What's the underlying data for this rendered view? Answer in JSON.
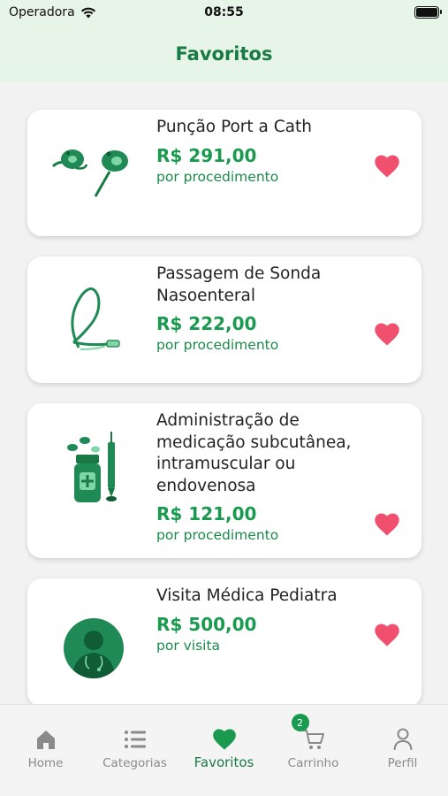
{
  "status_bar": {
    "carrier": "Operadora",
    "time": "08:55"
  },
  "header": {
    "title": "Favoritos"
  },
  "colors": {
    "accent": "#1a7a45",
    "price": "#1a9a4f",
    "heart": "#f0506e",
    "header_bg": "#e7f4e8"
  },
  "favorites": [
    {
      "name": "Punção Port a Cath",
      "price": "R$ 291,00",
      "unit": "por procedimento",
      "icon": "port-a-cath-icon"
    },
    {
      "name": "Passagem de Sonda Nasoenteral",
      "price": "R$ 222,00",
      "unit": "por procedimento",
      "icon": "feeding-tube-icon"
    },
    {
      "name": "Administração de medicação subcutânea, intramuscular ou endovenosa",
      "price": "R$ 121,00",
      "unit": "por procedimento",
      "icon": "medication-syringe-icon"
    },
    {
      "name": "Visita Médica Pediatra",
      "price": "R$ 500,00",
      "unit": "por visita",
      "icon": "doctor-avatar-icon"
    }
  ],
  "tabbar": {
    "tabs": [
      {
        "label": "Home",
        "icon": "home-icon"
      },
      {
        "label": "Categorias",
        "icon": "list-icon"
      },
      {
        "label": "Favoritos",
        "icon": "heart-icon"
      },
      {
        "label": "Carrinho",
        "icon": "cart-icon",
        "badge": "2"
      },
      {
        "label": "Perfil",
        "icon": "person-icon"
      }
    ]
  }
}
